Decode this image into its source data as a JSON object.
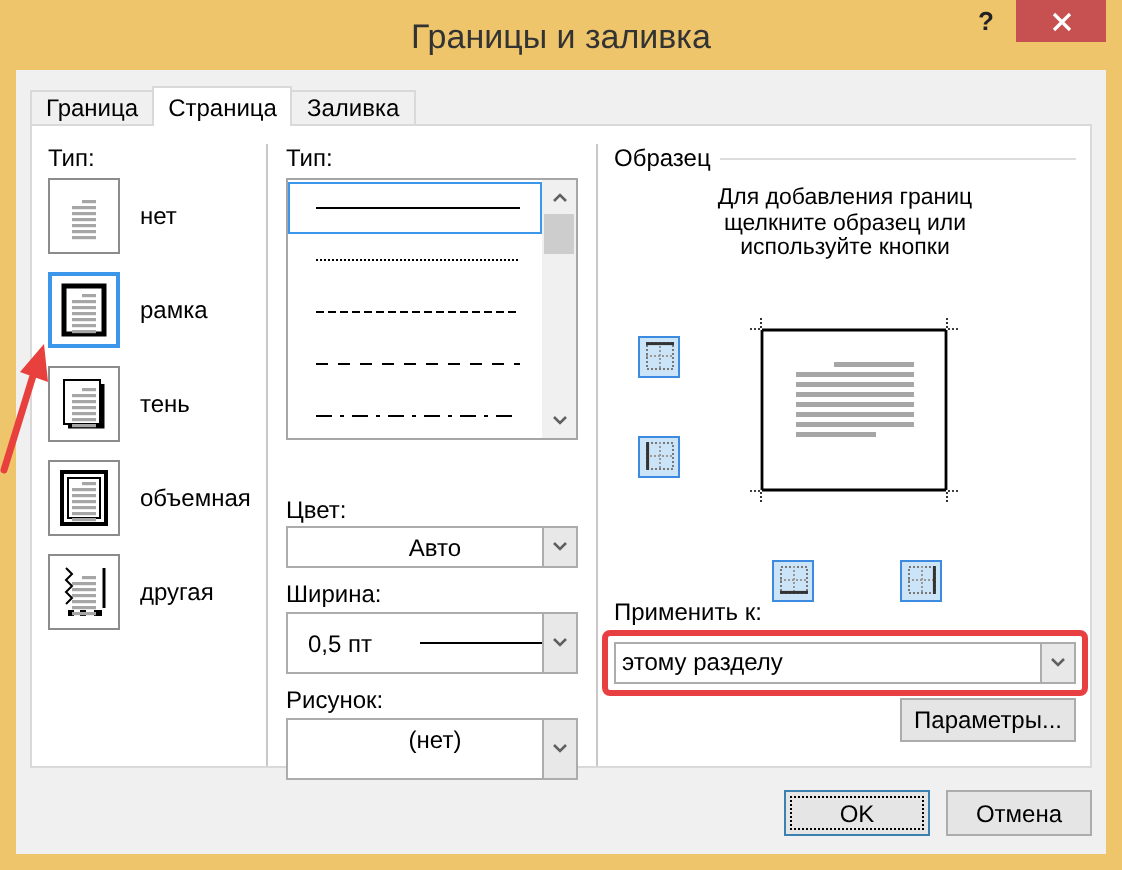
{
  "window": {
    "title": "Границы и заливка",
    "help": "?"
  },
  "tabs": [
    {
      "label": "Граница",
      "selected": false
    },
    {
      "label": "Страница",
      "selected": true
    },
    {
      "label": "Заливка",
      "selected": false
    }
  ],
  "setting": {
    "label": "Тип:",
    "items": [
      {
        "label": "нет",
        "kind": "none",
        "selected": false
      },
      {
        "label": "рамка",
        "kind": "box",
        "selected": true
      },
      {
        "label": "тень",
        "kind": "shadow",
        "selected": false
      },
      {
        "label": "объемная",
        "kind": "bevel",
        "selected": false
      },
      {
        "label": "другая",
        "kind": "custom",
        "selected": false
      }
    ]
  },
  "style": {
    "label": "Тип:",
    "items": [
      {
        "kind": "solid",
        "selected": true
      },
      {
        "kind": "dotted",
        "selected": false
      },
      {
        "kind": "dashed",
        "selected": false
      },
      {
        "kind": "long-dashed",
        "selected": false
      },
      {
        "kind": "dash-dot",
        "selected": false
      }
    ]
  },
  "color": {
    "label": "Цвет:",
    "value": "Авто"
  },
  "width": {
    "label": "Ширина:",
    "value": "0,5 пт"
  },
  "art": {
    "label": "Рисунок:",
    "value": "(нет)"
  },
  "preview": {
    "title": "Образец",
    "hint": "Для добавления границ щелкните образец или используйте кнопки",
    "border_buttons": [
      {
        "kind": "top",
        "on": true
      },
      {
        "kind": "bottom",
        "on": true
      },
      {
        "kind": "left",
        "on": true
      },
      {
        "kind": "right",
        "on": true
      }
    ]
  },
  "apply": {
    "label": "Применить к:",
    "value": "этому разделу",
    "highlighted": true
  },
  "options_button": "Параметры...",
  "buttons": [
    {
      "label": "OK",
      "default": true
    },
    {
      "label": "Отмена",
      "default": false
    }
  ]
}
